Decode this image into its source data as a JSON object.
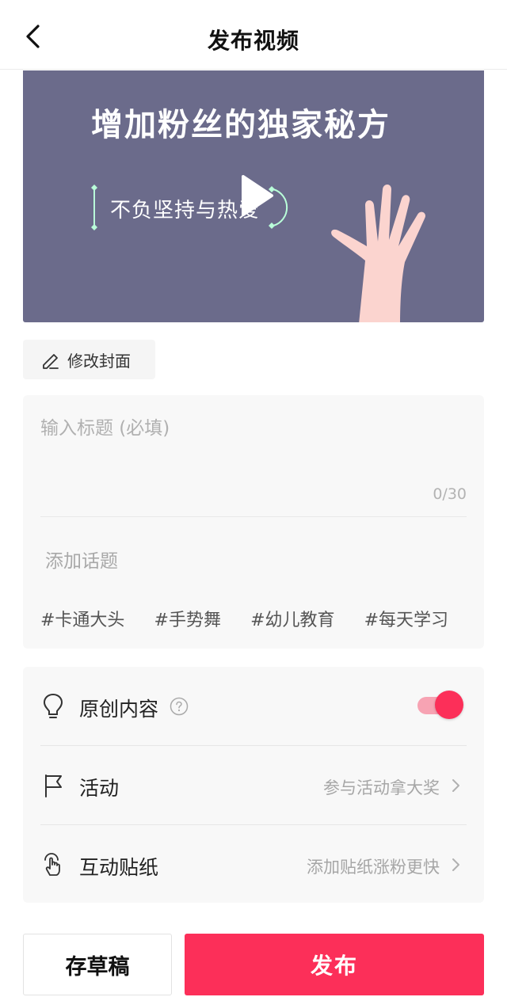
{
  "header": {
    "title": "发布视频"
  },
  "cover": {
    "title": "增加粉丝的独家秘方",
    "subtitle": "不负坚持与热爱",
    "bg_color": "#6b6b8b"
  },
  "edit_cover": {
    "label": "修改封面"
  },
  "title_card": {
    "placeholder": "输入标题 (必填)",
    "value": "",
    "char_count": "0/30",
    "add_topic": "添加话题",
    "tags": [
      "#卡通大头",
      "#手势舞",
      "#幼儿教育",
      "#每天学习"
    ]
  },
  "settings": {
    "original": {
      "label": "原创内容",
      "enabled": true
    },
    "activity": {
      "label": "活动",
      "value": "参与活动拿大奖"
    },
    "sticker": {
      "label": "互动贴纸",
      "value": "添加贴纸涨粉更快"
    }
  },
  "footer": {
    "draft_label": "存草稿",
    "publish_label": "发布"
  },
  "colors": {
    "accent": "#fc2f59",
    "toggle_track": "#f7a3b3"
  },
  "icons": {
    "back": "chevron-left-icon",
    "play": "play-icon",
    "edit": "pencil-icon",
    "original": "lightbulb-icon",
    "help": "question-circle-icon",
    "activity": "flag-icon",
    "sticker": "touch-hand-icon",
    "arrow": "chevron-right-icon"
  }
}
